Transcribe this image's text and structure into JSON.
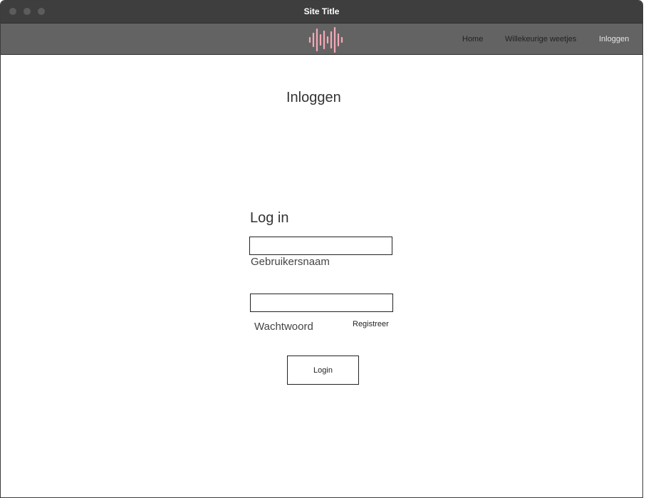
{
  "window": {
    "title": "Site Title"
  },
  "navbar": {
    "logo_icon": "soundwave-logo-icon",
    "logo_color": "#f4a8b8",
    "links": [
      {
        "label": "Home"
      },
      {
        "label": "Willekeurige weetjes"
      },
      {
        "label": "Inloggen",
        "active": true
      }
    ]
  },
  "page": {
    "heading": "Inloggen"
  },
  "login_form": {
    "title": "Log in",
    "username": {
      "value": "",
      "label": "Gebruikersnaam"
    },
    "password": {
      "value": "",
      "label": "Wachtwoord"
    },
    "register_link": "Registreer",
    "submit_label": "Login"
  }
}
